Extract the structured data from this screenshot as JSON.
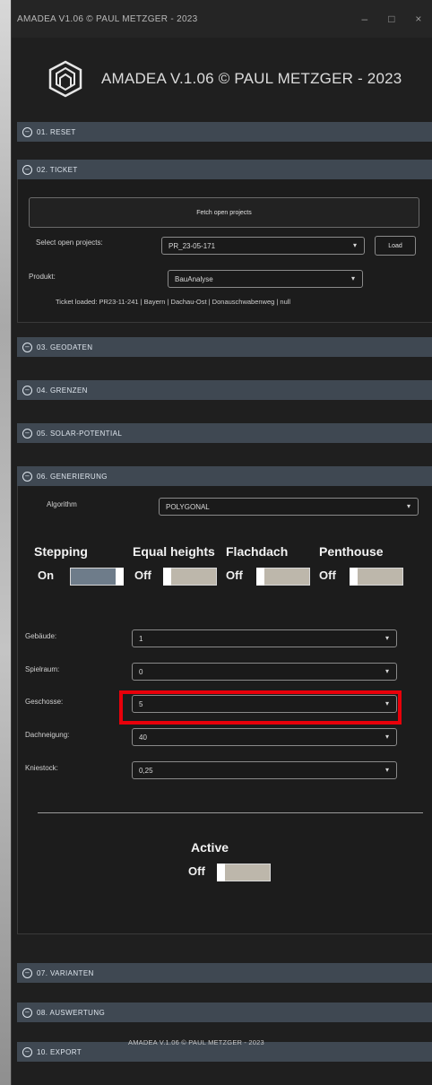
{
  "window": {
    "title": "AMADEA V1.06 © PAUL METZGER - 2023",
    "minimize": "–",
    "maximize": "□",
    "close": "×"
  },
  "header": {
    "app_title": "AMADEA V.1.06 © PAUL METZGER - 2023"
  },
  "sections": {
    "reset": "01. RESET",
    "ticket": "02. TICKET",
    "geodaten": "03. GEODATEN",
    "grenzen": "04. GRENZEN",
    "solar": "05. SOLAR-POTENTIAL",
    "generierung": "06. GENERIERUNG",
    "varianten": "07. VARIANTEN",
    "auswertung": "08. AUSWERTUNG",
    "export": "10. EXPORT"
  },
  "ticket": {
    "fetch_label": "Fetch open projects",
    "select_label": "Select open projects:",
    "select_value": "PR_23-05-171",
    "load_label": "Load",
    "produkt_label": "Produkt:",
    "produkt_value": "BauAnalyse",
    "loaded_info": "Ticket loaded: PR23-11-241 | Bayern | Dachau-Ost | Donauschwabenweg | null"
  },
  "generierung": {
    "algorithm_label": "Algorithm",
    "algorithm_value": "POLYGONAL",
    "toggles": [
      {
        "title": "Stepping",
        "state": "On",
        "on": true
      },
      {
        "title": "Equal heights",
        "state": "Off",
        "on": false
      },
      {
        "title": "Flachdach",
        "state": "Off",
        "on": false
      },
      {
        "title": "Penthouse",
        "state": "Off",
        "on": false
      }
    ],
    "fields": [
      {
        "label": "Gebäude:",
        "value": "1"
      },
      {
        "label": "Spielraum:",
        "value": "0"
      },
      {
        "label": "Geschosse:",
        "value": "5"
      },
      {
        "label": "Dachneigung:",
        "value": "40"
      },
      {
        "label": "Kniestock:",
        "value": "0,25"
      }
    ],
    "active_title": "Active",
    "active_state": "Off"
  },
  "footer": {
    "text": "AMADEA V.1.06 © PAUL METZGER - 2023"
  },
  "colors": {
    "highlight": "#e8000a",
    "section_header": "#3f4852"
  },
  "icons": {
    "chevron": "▾",
    "collapse": "⊖"
  }
}
